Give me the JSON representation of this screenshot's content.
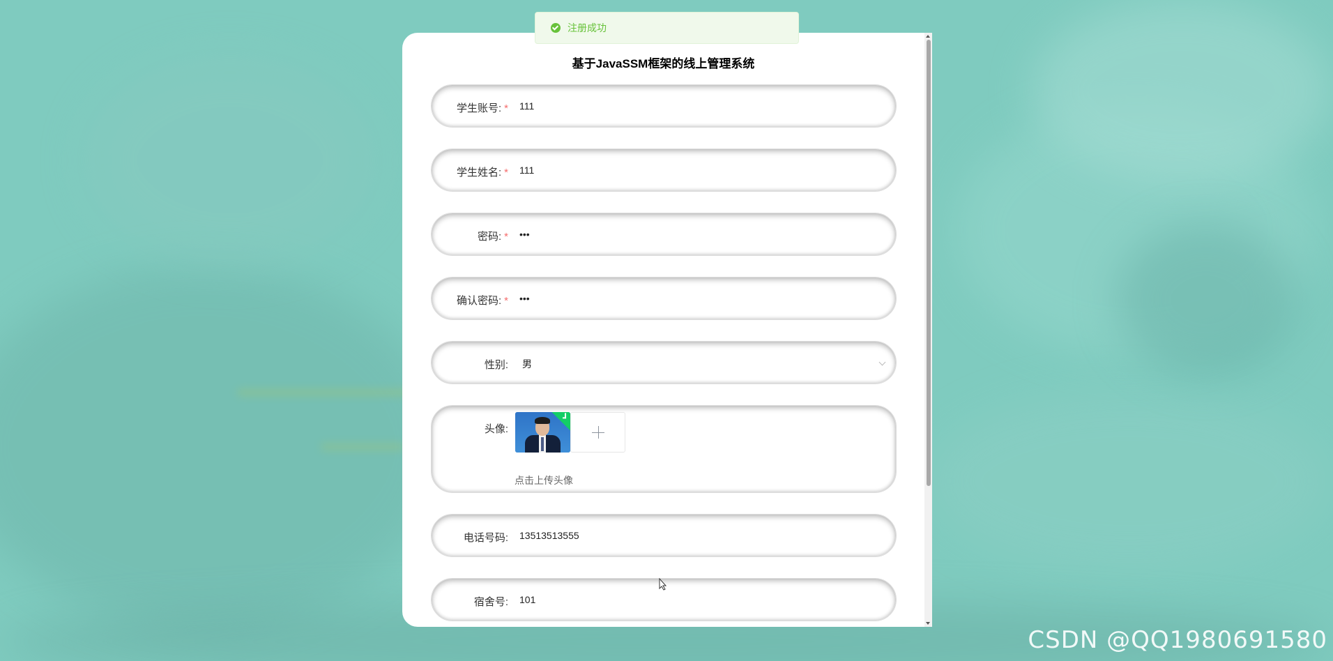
{
  "toast": {
    "message": "注册成功",
    "type": "success"
  },
  "form": {
    "title": "基于JavaSSM框架的线上管理系统",
    "student_account": {
      "label": "学生账号:",
      "required": true,
      "value": "111"
    },
    "student_name": {
      "label": "学生姓名:",
      "required": true,
      "value": "111"
    },
    "password": {
      "label": "密码:",
      "required": true,
      "value": "111"
    },
    "confirm_password": {
      "label": "确认密码:",
      "required": true,
      "value": "111"
    },
    "gender": {
      "label": "性别:",
      "value": "男"
    },
    "avatar": {
      "label": "头像:",
      "hint": "点击上传头像",
      "uploaded": true
    },
    "phone": {
      "label": "电话号码:",
      "value": "13513513555"
    },
    "dorm": {
      "label": "宿舍号:",
      "value": "101"
    },
    "required_mark": "*"
  },
  "watermark": "CSDN @QQ1980691580",
  "colors": {
    "background": "#7fcbbf",
    "success": "#67c23a",
    "required": "#f56c6c"
  }
}
